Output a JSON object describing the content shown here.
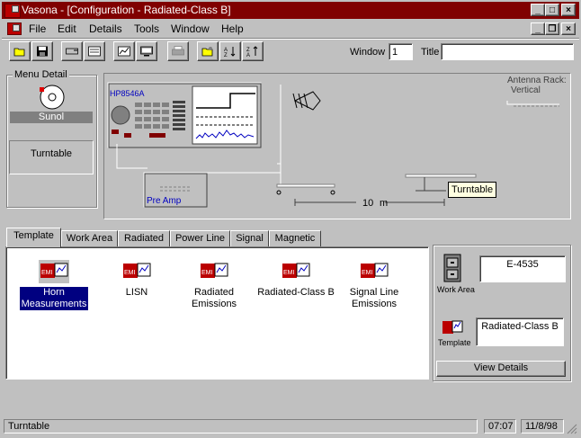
{
  "window": {
    "title": "Vasona - [Configuration - Radiated-Class B]",
    "min_glyph": "_",
    "max_glyph": "□",
    "close_glyph": "×",
    "restore_glyph": "❐"
  },
  "menu": [
    {
      "label": "File"
    },
    {
      "label": "Edit"
    },
    {
      "label": "Details"
    },
    {
      "label": "Tools"
    },
    {
      "label": "Window"
    },
    {
      "label": "Help"
    }
  ],
  "toolbar": {
    "window_label": "Window",
    "window_value": "1",
    "title_label": "Title",
    "title_value": "",
    "buttons": [
      "open-icon",
      "save-icon",
      "print-setup-icon",
      "test-icon",
      "graph-icon",
      "monitor-icon",
      "print-icon",
      "folder-keys-icon",
      "sort-ascending-icon",
      "sort-descending-icon"
    ]
  },
  "menu_detail": {
    "group_label": "Menu Detail",
    "device_label": "Sunol",
    "selection": "Turntable"
  },
  "diagram": {
    "analyzer_label": "HP8546A",
    "preamp_label": "Pre Amp",
    "antenna_rack_label": "Antenna Rack:",
    "antenna_rack_value": "Vertical",
    "distance": "10",
    "distance_unit": "m",
    "turntable_tooltip": "Turntable"
  },
  "tabs": [
    {
      "label": "Template",
      "active": true
    },
    {
      "label": "Work Area",
      "active": false
    },
    {
      "label": "Radiated",
      "active": false
    },
    {
      "label": "Power Line",
      "active": false
    },
    {
      "label": "Signal",
      "active": false
    },
    {
      "label": "Magnetic",
      "active": false
    }
  ],
  "templates": [
    {
      "line1": "Horn",
      "line2": "Measurements",
      "selected": true
    },
    {
      "line1": "LISN",
      "line2": "",
      "selected": false
    },
    {
      "line1": "Radiated",
      "line2": "Emissions",
      "selected": false
    },
    {
      "line1": "Radiated-Class B",
      "line2": "",
      "selected": false
    },
    {
      "line1": "Signal Line",
      "line2": "Emissions",
      "selected": false
    }
  ],
  "right_panel": {
    "work_area_label": "Work Area",
    "work_area_value": "E-4535",
    "template_label": "Template",
    "template_value": "Radiated-Class B",
    "view_details": "View Details"
  },
  "status": {
    "message": "Turntable",
    "time": "07:07",
    "date": "11/8/98"
  },
  "colors": {
    "titlebar": "#800000",
    "selection": "#000080",
    "diagram_blue": "#0000c0"
  }
}
